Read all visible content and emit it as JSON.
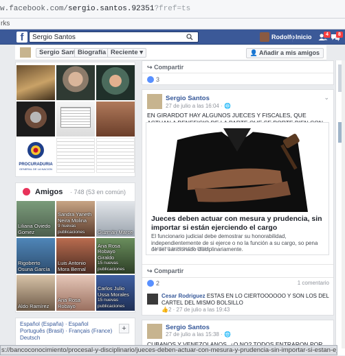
{
  "browser": {
    "url_prefix": "w.facebook.com/",
    "url_path": "sergio.santos.92351",
    "url_tail": "?fref=ts",
    "bookmarks_label": "rks"
  },
  "topbar": {
    "search_value": "Sergio Santos",
    "user_name": "Rodolfo",
    "home_label": "Inicio",
    "friend_requests_badge": "4",
    "messages_badge": "8"
  },
  "profile_nav": {
    "name": "Sergio Santos",
    "bio_label": "Biografía",
    "recent_label": "Reciente",
    "add_friend_label": "Añadir a mis amigos"
  },
  "friends": {
    "title": "Amigos",
    "count": "· 748 (53 en común)",
    "items": [
      {
        "name": "Liliana Oviedo Gomez",
        "sub": ""
      },
      {
        "name": "Sandra Yaneth Neira Molina",
        "sub": "9 nuevas publicaciones"
      },
      {
        "name": "Guzmán Marce",
        "sub": ""
      },
      {
        "name": "Rigoberto Osuna García",
        "sub": ""
      },
      {
        "name": "Luis Antonio Mora Bernal",
        "sub": ""
      },
      {
        "name": "Ana Rosa Robayo Giraldo",
        "sub": "15 nuevas publicaciones"
      },
      {
        "name": "Aldo Ramírez",
        "sub": ""
      },
      {
        "name": "Ana Rosa Robayo",
        "sub": ""
      },
      {
        "name": "Carlos Julio Ussa Morales",
        "sub": "15 nuevas publicaciones"
      }
    ]
  },
  "languages": {
    "line1a": "Español (España)",
    "line1b": "Español",
    "line2a": "Português (Brasil)",
    "line2b": "Français (France)",
    "line3": "Deutsch",
    "plus": "+"
  },
  "photos": {
    "seal_text": "PROCURADURIA GENERAL DE LA NACION"
  },
  "feed": {
    "top_share_label": "Compartir",
    "top_likes": "3",
    "post": {
      "author": "Sergio Santos",
      "time": "27 de julio a las 16:04 · ",
      "text": "EN GIRARDOT HAY ALGUNOS JUECES Y FISCALES, QUE ACTUAN A BENEFICIO DE LA PARTE QUE SE PORTE BIEN CON ELLO$$$$$.",
      "link_title": "Jueces deben actuar con mesura y prudencia, sin importar si están ejerciendo el cargo",
      "link_desc": "El funcionario judicial debe demostrar su honorabilidad, independientemente de si ejerce o no la función a su cargo, so pena de ser sancionado disciplinariamente.",
      "link_domain": "AMBITOJURIDICO.COM",
      "share_label": "Compartir",
      "likes": "2",
      "comments_label": "1 comentario",
      "comment_author": "Cesar Rodriguez",
      "comment_text": "ESTAS EN LO CIERTOOOOOO Y SON LOS DEL CARTEL DEL MISMO BOLSILLO",
      "comment_likes": "2",
      "comment_meta": "· 27 de julio a las 19:43"
    },
    "post2": {
      "author": "Sergio Santos",
      "time": "27 de julio a las 15:38 · ",
      "text": "CUBANOS Y VENEZOLANOS, ¿O NO? TODOS ENTRARON POR LA"
    }
  },
  "status_url": "s://bancoconocimiento/procesal-y-disciplinario/jueces-deben-actuar-con-mesura-y-prudencia-sin-importar-si-estan-ejerciendo-el-cargo",
  "colors": {
    "fb_blue": "#3b5998",
    "link_blue": "#365899",
    "badge_red": "#fa3e3e",
    "like_blue": "#5890ff"
  }
}
